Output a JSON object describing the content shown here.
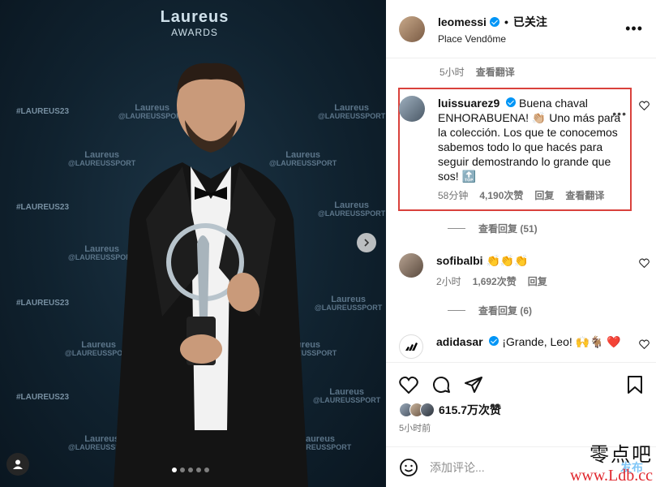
{
  "photo": {
    "logo_word": "Laureus",
    "logo_sub": "AWARDS",
    "hashtag": "#LAUREUS23",
    "wm_word": "Laureus",
    "wm_handle": "@LAUREUSSPORT"
  },
  "header": {
    "username": "leomessi",
    "separator": "•",
    "follow_label": "已关注",
    "location": "Place Vendôme"
  },
  "comments": {
    "top_meta": {
      "time": "5小时",
      "translate": "查看翻译"
    },
    "items": [
      {
        "username": "luissuarez9",
        "text": "Buena chaval ENHORABUENA! 👏🏼 Uno más para la colección. Los que te conocemos sabemos todo lo que hacés para seguir demostrando lo grande que sos! 🔝",
        "time": "58分钟",
        "likes": "4,190次赞",
        "reply": "回复",
        "translate": "查看翻译",
        "view_replies": "查看回复 (51)"
      },
      {
        "username": "sofibalbi",
        "text": "👏👏👏",
        "time": "2小时",
        "likes": "1,692次赞",
        "reply": "回复",
        "view_replies": "查看回复 (6)"
      },
      {
        "username": "adidasar",
        "text": "¡Grande, Leo! 🙌🐐 ❤️"
      }
    ]
  },
  "actions": {
    "likes": "615.7万次赞",
    "time_ago": "5小时前"
  },
  "add_comment": {
    "placeholder": "添加评论...",
    "post_label": "发布"
  },
  "site_watermark": {
    "zh": "零点吧",
    "url": "www.Ldb.cc"
  },
  "colors": {
    "verified": "#0095f6",
    "highlight": "#d9413c",
    "watermark_url": "#e0262d"
  }
}
